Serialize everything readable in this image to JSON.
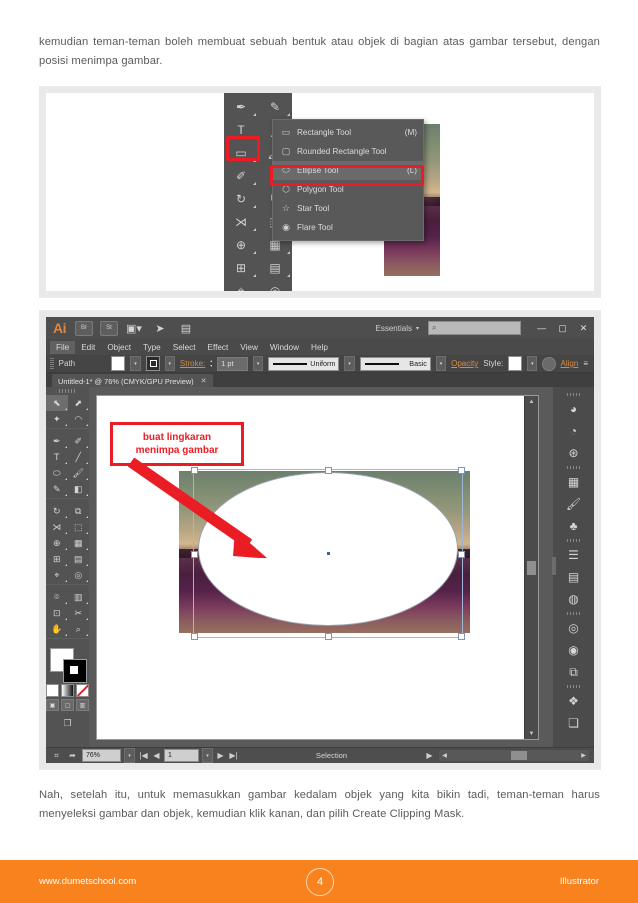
{
  "document": {
    "paragraph_top": "kemudian teman-teman boleh membuat sebuah bentuk atau objek di bagian atas gambar tersebut, dengan posisi menimpa gambar.",
    "paragraph_bottom": "Nah, setelah itu, untuk memasukkan gambar kedalam objek yang kita bikin tadi, teman-teman harus menyeleksi gambar dan objek, kemudian klik kanan, dan pilih Create Clipping Mask."
  },
  "figure1": {
    "flyout_menu": {
      "items": [
        {
          "label": "Rectangle Tool",
          "shortcut": "(M)",
          "icon": "rectangle-icon",
          "highlighted": false
        },
        {
          "label": "Rounded Rectangle Tool",
          "shortcut": "",
          "icon": "rounded-rectangle-icon",
          "highlighted": false
        },
        {
          "label": "Ellipse Tool",
          "shortcut": "(L)",
          "icon": "ellipse-icon",
          "highlighted": true
        },
        {
          "label": "Polygon Tool",
          "shortcut": "",
          "icon": "polygon-icon",
          "highlighted": false
        },
        {
          "label": "Star Tool",
          "shortcut": "",
          "icon": "star-icon",
          "highlighted": false
        },
        {
          "label": "Flare Tool",
          "shortcut": "",
          "icon": "flare-icon",
          "highlighted": false
        }
      ]
    },
    "tool_column": [
      "pen-icon",
      "pencil-icon",
      "type-icon",
      "line-icon",
      "rectangle-icon",
      "paintbrush-icon",
      "blob-brush-icon",
      "eraser-icon",
      "rotate-icon",
      "scale-icon",
      "width-icon",
      "free-transform-icon",
      "shape-builder-icon",
      "perspective-grid-icon",
      "mesh-icon",
      "gradient-icon",
      "eyedropper-icon",
      "blend-icon",
      "symbol-sprayer-icon",
      "column-graph-icon"
    ],
    "highlight_color": "#ed1c24"
  },
  "illustrator": {
    "app_title": "Ai",
    "app_bar_buttons": [
      "Br",
      "St"
    ],
    "app_bar_icons": [
      "arrange-documents-icon",
      "go-to-bridge-icon",
      "stock-icon"
    ],
    "workspace": "Essentials",
    "search_placeholder": "",
    "search_icon": "search-icon",
    "window_controls": [
      "minimize",
      "maximize",
      "close"
    ],
    "menu_items": [
      "File",
      "Edit",
      "Object",
      "Type",
      "Select",
      "Effect",
      "View",
      "Window",
      "Help"
    ],
    "active_menu": "File",
    "control_bar": {
      "object_type": "Path",
      "stroke_label": "Stroke:",
      "stroke_weight": "1 pt",
      "stroke_profile": "Uniform",
      "brush_definition": "Basic",
      "opacity_label": "Opacity",
      "style_label": "Style:",
      "align_label": "Align",
      "fill_color": "#ffffff",
      "stroke_color": "#000000",
      "accent_color": "#d98a3a"
    },
    "document_tab": {
      "title": "Untitled-1* @ 76% (CMYK/GPU Preview)",
      "close_icon": "close-icon"
    },
    "tools": [
      "selection-icon",
      "direct-selection-icon",
      "magic-wand-icon",
      "lasso-icon",
      "pen-icon",
      "curvature-icon",
      "type-icon",
      "line-segment-icon",
      "ellipse-icon",
      "paintbrush-icon",
      "pencil-icon",
      "eraser-icon",
      "rotate-icon",
      "scale-icon",
      "width-icon",
      "free-transform-icon",
      "shape-builder-icon",
      "perspective-grid-icon",
      "mesh-icon",
      "gradient-icon",
      "eyedropper-icon",
      "blend-icon",
      "symbol-sprayer-icon",
      "column-graph-icon",
      "artboard-icon",
      "slice-icon",
      "hand-icon",
      "zoom-icon"
    ],
    "active_tool": "selection-icon",
    "fill_color": "#ffffff",
    "stroke_color": "#000000",
    "color_modes": [
      "color-swatch-icon",
      "gradient-icon",
      "none-icon"
    ],
    "draw_modes": [
      "draw-normal-icon",
      "draw-behind-icon",
      "draw-inside-icon"
    ],
    "screen_mode_icon": "screen-mode-icon",
    "dock_panels": [
      [
        "color-panel-icon",
        "color-guide-icon",
        "edit-colors-icon"
      ],
      [
        "swatches-panel-icon",
        "brushes-panel-icon",
        "symbols-panel-icon"
      ],
      [
        "align-panel-icon",
        "transform-panel-icon",
        "pathfinder-panel-icon"
      ],
      [
        "stroke-panel-icon",
        "gradient-panel-icon",
        "transparency-panel-icon"
      ],
      [
        "layers-panel-icon",
        "artboards-panel-icon"
      ]
    ],
    "annotation": {
      "line1": "buat lingkaran",
      "line2": "menimpa gambar",
      "color": "#ea1d24",
      "arrow_icon": "arrow-icon"
    },
    "status_bar": {
      "zoom": "76%",
      "page": "1",
      "status_text": "Selection",
      "cut_icon": "cut-icon",
      "share-icon": "share-icon",
      "first_page_icon": "first-page-icon",
      "prev_page_icon": "prev-page-icon",
      "next_page_icon": "next-page-icon",
      "last_page_icon": "last-page-icon"
    }
  },
  "footer": {
    "website": "www.dumetschool.com",
    "page_number": "4",
    "topic": "Illustrator",
    "background_color": "#f7821e"
  }
}
